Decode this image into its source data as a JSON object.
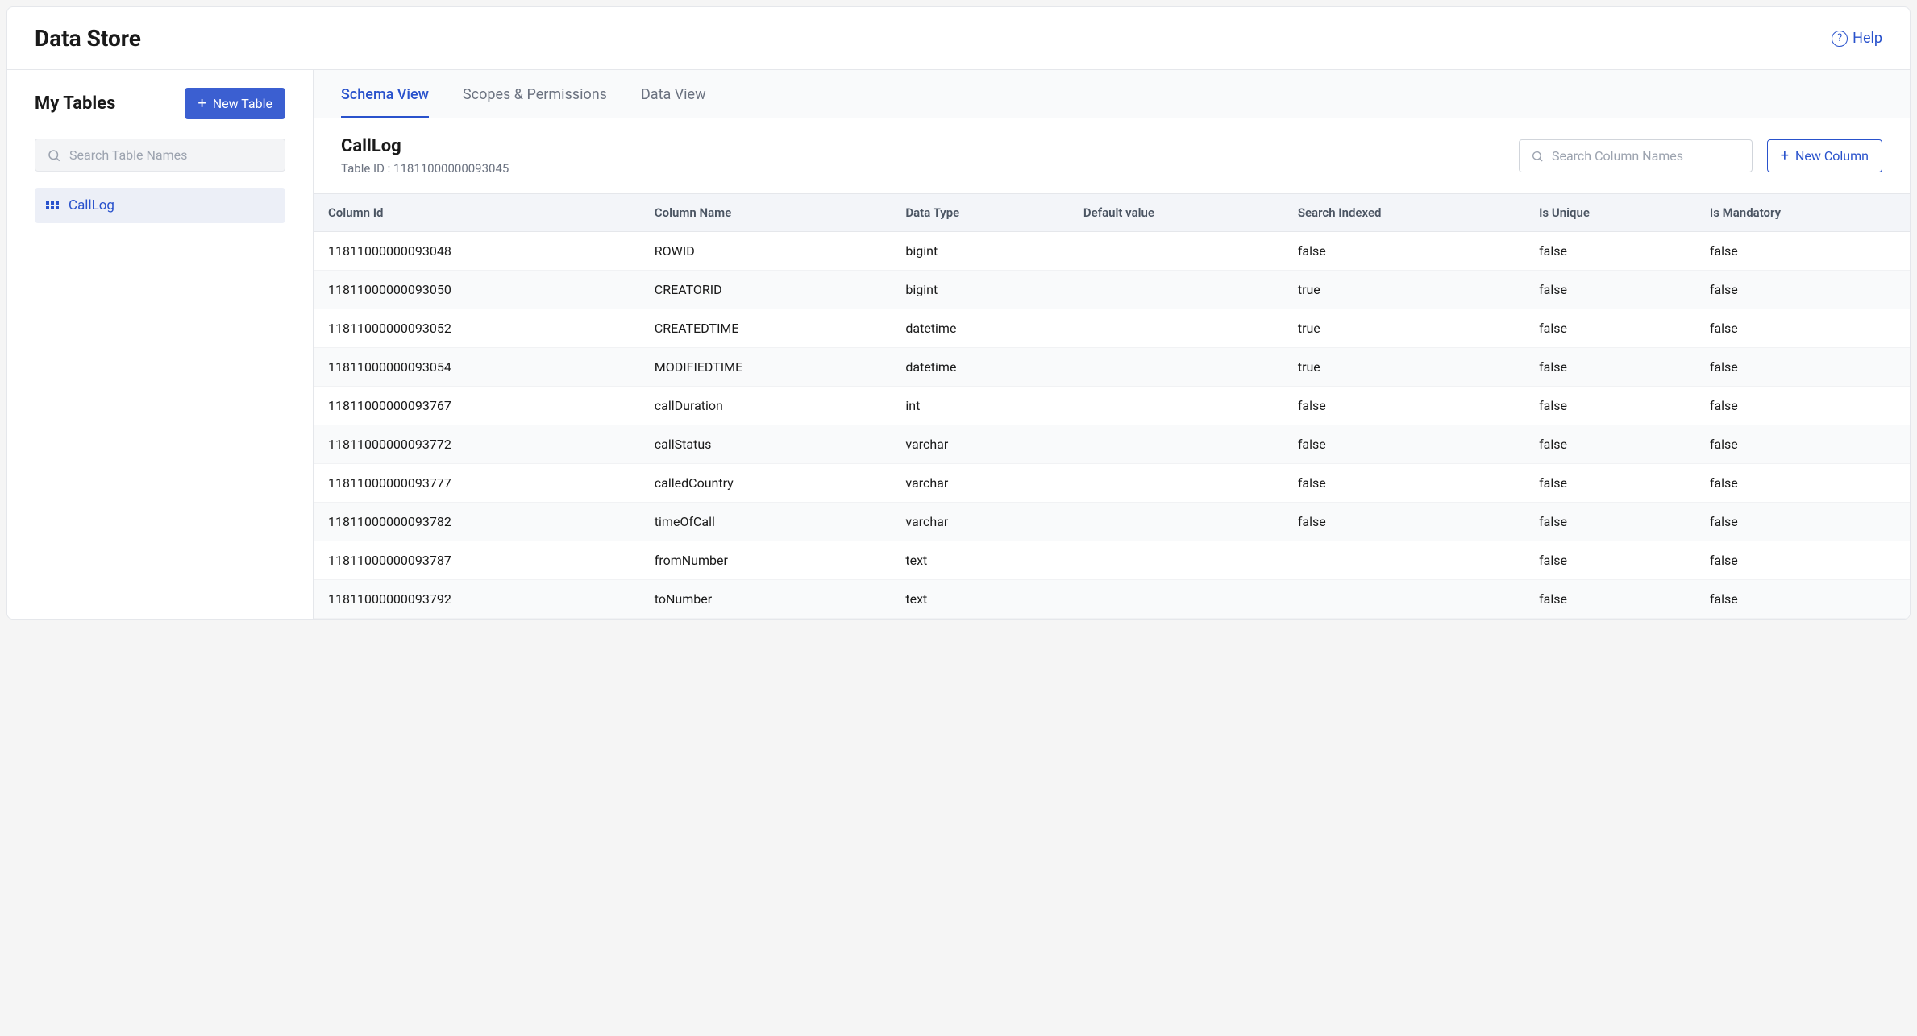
{
  "header": {
    "title": "Data Store",
    "help_label": "Help"
  },
  "sidebar": {
    "title": "My Tables",
    "new_table_label": "New Table",
    "search_placeholder": "Search Table Names",
    "items": [
      {
        "name": "CallLog"
      }
    ]
  },
  "tabs": [
    {
      "label": "Schema View",
      "active": true
    },
    {
      "label": "Scopes & Permissions",
      "active": false
    },
    {
      "label": "Data View",
      "active": false
    }
  ],
  "table_meta": {
    "name": "CallLog",
    "id_label": "Table ID : 11811000000093045",
    "search_placeholder": "Search Column Names",
    "new_column_label": "New Column"
  },
  "columns_table": {
    "headers": [
      "Column Id",
      "Column Name",
      "Data Type",
      "Default value",
      "Search Indexed",
      "Is Unique",
      "Is Mandatory"
    ],
    "rows": [
      {
        "col_id": "11811000000093048",
        "col_name": "ROWID",
        "data_type": "bigint",
        "default_value": "",
        "search_indexed": "false",
        "is_unique": "false",
        "is_mandatory": "false"
      },
      {
        "col_id": "11811000000093050",
        "col_name": "CREATORID",
        "data_type": "bigint",
        "default_value": "",
        "search_indexed": "true",
        "is_unique": "false",
        "is_mandatory": "false"
      },
      {
        "col_id": "11811000000093052",
        "col_name": "CREATEDTIME",
        "data_type": "datetime",
        "default_value": "",
        "search_indexed": "true",
        "is_unique": "false",
        "is_mandatory": "false"
      },
      {
        "col_id": "11811000000093054",
        "col_name": "MODIFIEDTIME",
        "data_type": "datetime",
        "default_value": "",
        "search_indexed": "true",
        "is_unique": "false",
        "is_mandatory": "false"
      },
      {
        "col_id": "11811000000093767",
        "col_name": "callDuration",
        "data_type": "int",
        "default_value": "",
        "search_indexed": "false",
        "is_unique": "false",
        "is_mandatory": "false"
      },
      {
        "col_id": "11811000000093772",
        "col_name": "callStatus",
        "data_type": "varchar",
        "default_value": "",
        "search_indexed": "false",
        "is_unique": "false",
        "is_mandatory": "false"
      },
      {
        "col_id": "11811000000093777",
        "col_name": "calledCountry",
        "data_type": "varchar",
        "default_value": "",
        "search_indexed": "false",
        "is_unique": "false",
        "is_mandatory": "false"
      },
      {
        "col_id": "11811000000093782",
        "col_name": "timeOfCall",
        "data_type": "varchar",
        "default_value": "",
        "search_indexed": "false",
        "is_unique": "false",
        "is_mandatory": "false"
      },
      {
        "col_id": "11811000000093787",
        "col_name": "fromNumber",
        "data_type": "text",
        "default_value": "",
        "search_indexed": "",
        "is_unique": "false",
        "is_mandatory": "false"
      },
      {
        "col_id": "11811000000093792",
        "col_name": "toNumber",
        "data_type": "text",
        "default_value": "",
        "search_indexed": "",
        "is_unique": "false",
        "is_mandatory": "false"
      }
    ]
  }
}
